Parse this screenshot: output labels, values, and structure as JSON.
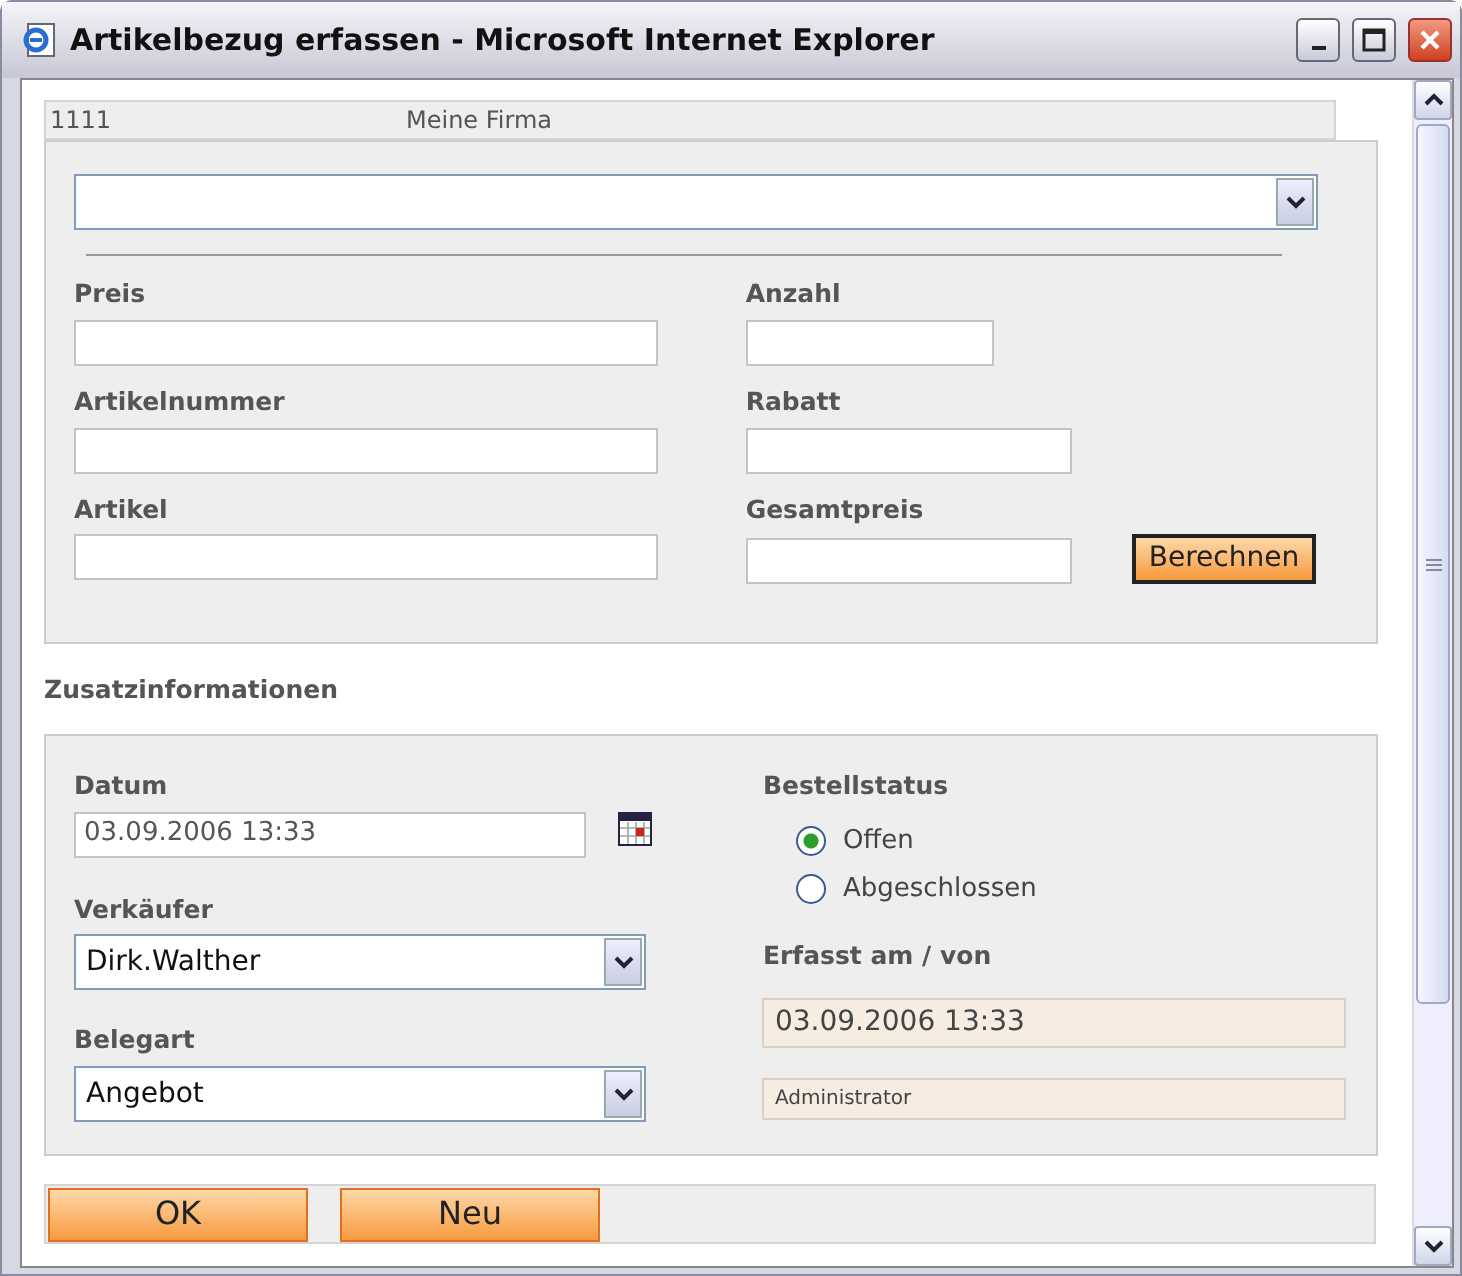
{
  "window": {
    "title": "Artikelbezug erfassen - Microsoft Internet Explorer"
  },
  "header": {
    "number": "1111",
    "company": "Meine Firma"
  },
  "article_panel": {
    "left_fields": [
      {
        "label": "Preis"
      },
      {
        "label": "Artikelnummer"
      },
      {
        "label": "Artikel"
      }
    ],
    "right_fields": [
      {
        "label": "Anzahl"
      },
      {
        "label": "Rabatt"
      },
      {
        "label": "Gesamtpreis"
      }
    ],
    "calculate_button": "Berechnen"
  },
  "extra_heading": "Zusatzinformationen",
  "extra_panel": {
    "date": {
      "label": "Datum",
      "value": "03.09.2006 13:33"
    },
    "seller": {
      "label": "Verkäufer",
      "value": "Dirk.Walther"
    },
    "document_type": {
      "label": "Belegart",
      "value": "Angebot"
    },
    "order_status": {
      "label": "Bestellstatus",
      "options": [
        {
          "label": "Offen",
          "selected": true
        },
        {
          "label": "Abgeschlossen",
          "selected": false
        }
      ]
    },
    "created": {
      "label": "Erfasst am / von",
      "date": "03.09.2006 13:33",
      "user": "Administrator"
    }
  },
  "buttons": [
    "OK",
    "Neu"
  ]
}
